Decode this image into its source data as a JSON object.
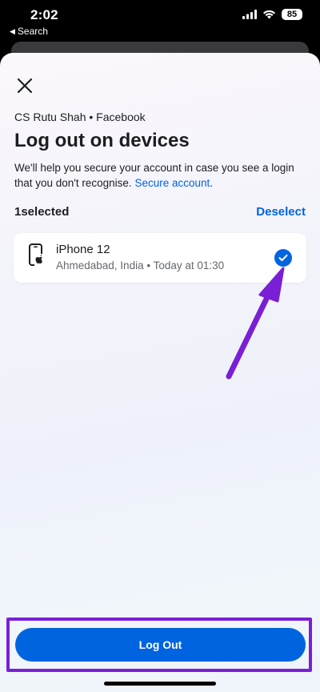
{
  "status_bar": {
    "time": "2:02",
    "back_app": "Search",
    "battery": "85"
  },
  "header": {
    "account": "CS Rutu Shah • Facebook",
    "title": "Log out on devices",
    "description": "We'll help you secure your account in case you see a login that you don't recognise.",
    "secure_link": "Secure account"
  },
  "selection": {
    "count_label": "1selected",
    "deselect_label": "Deselect"
  },
  "devices": [
    {
      "name": "iPhone 12",
      "meta": "Ahmedabad, India • Today at 01:30",
      "selected": true
    }
  ],
  "footer": {
    "logout_label": "Log Out"
  },
  "colors": {
    "accent": "#0064e0",
    "annotation": "#7a1fd6"
  }
}
